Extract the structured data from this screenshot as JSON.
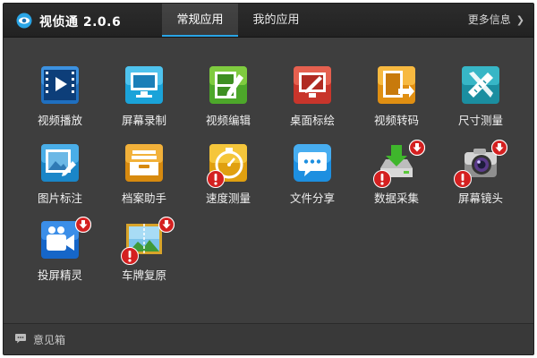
{
  "window": {
    "app_name": "视侦通 2.0.6",
    "logo_icon": "eye-logo-icon"
  },
  "tabs": [
    {
      "label": "常规应用",
      "active": true
    },
    {
      "label": "我的应用",
      "active": false
    }
  ],
  "header": {
    "more_label": "更多信息"
  },
  "apps": [
    {
      "label": "视频播放",
      "icon": "video-play-icon",
      "download": false,
      "warning": false
    },
    {
      "label": "屏幕录制",
      "icon": "screen-record-icon",
      "download": false,
      "warning": false
    },
    {
      "label": "视频编辑",
      "icon": "video-edit-icon",
      "download": false,
      "warning": false
    },
    {
      "label": "桌面标绘",
      "icon": "desktop-draw-icon",
      "download": false,
      "warning": false
    },
    {
      "label": "视频转码",
      "icon": "video-transcode-icon",
      "download": false,
      "warning": false
    },
    {
      "label": "尺寸测量",
      "icon": "size-measure-icon",
      "download": false,
      "warning": false
    },
    {
      "label": "图片标注",
      "icon": "image-annotate-icon",
      "download": false,
      "warning": false
    },
    {
      "label": "档案助手",
      "icon": "archive-assistant-icon",
      "download": false,
      "warning": false
    },
    {
      "label": "速度测量",
      "icon": "speed-measure-icon",
      "download": false,
      "warning": true
    },
    {
      "label": "文件分享",
      "icon": "file-share-icon",
      "download": false,
      "warning": false
    },
    {
      "label": "数据采集",
      "icon": "data-collect-icon",
      "download": true,
      "warning": true
    },
    {
      "label": "屏幕镜头",
      "icon": "screen-camera-icon",
      "download": true,
      "warning": true
    },
    {
      "label": "投屏精灵",
      "icon": "screen-cast-icon",
      "download": true,
      "warning": false
    },
    {
      "label": "车牌复原",
      "icon": "plate-restore-icon",
      "download": true,
      "warning": true
    }
  ],
  "footer": {
    "feedback_label": "意见箱",
    "feedback_icon": "chat-bubble-icon"
  },
  "colors": {
    "accent": "#2aa5e6",
    "background": "#3e3e3e",
    "download_badge": "#d42020",
    "warning_badge": "#d42020"
  }
}
